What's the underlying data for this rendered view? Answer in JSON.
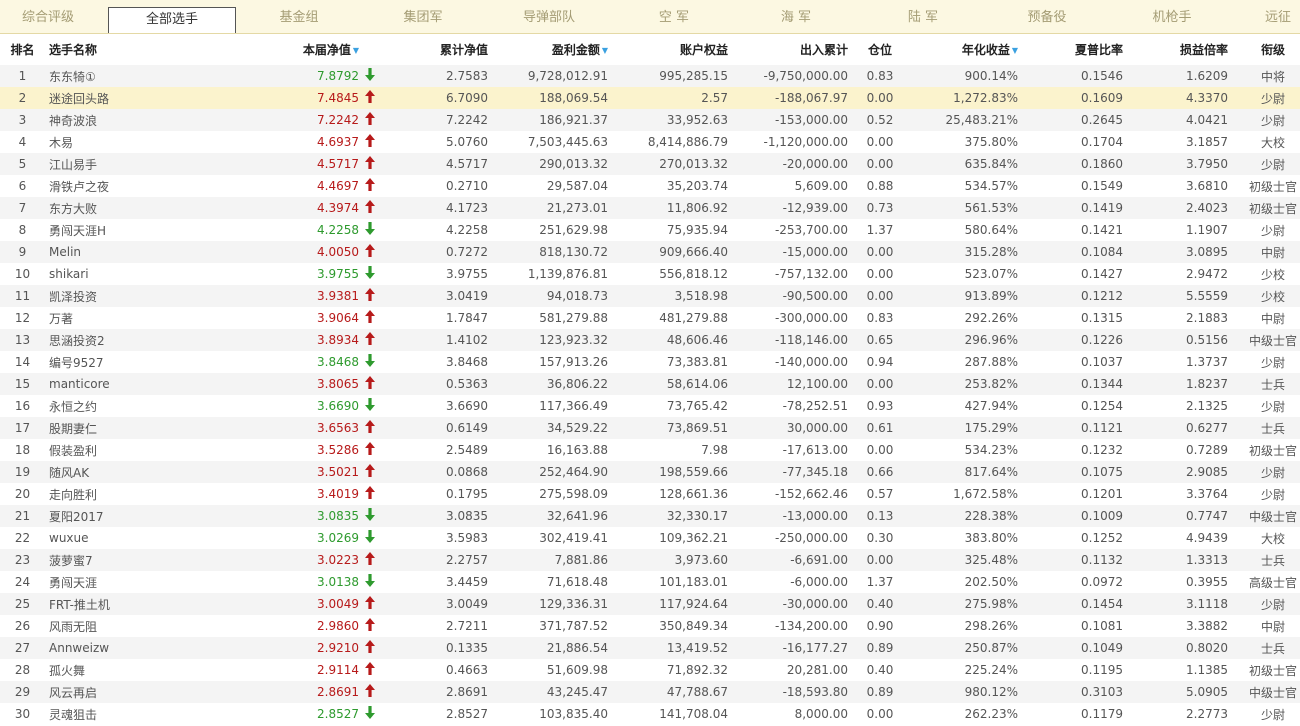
{
  "tabs": [
    "综合评级",
    "全部选手",
    "基金组",
    "集团军",
    "导弹部队",
    "空 军",
    "海 军",
    "陆 军",
    "预备役",
    "机枪手",
    "远征"
  ],
  "active_tab": 1,
  "headers": [
    "排名",
    "选手名称",
    "本届净值",
    "累计净值",
    "盈利金额",
    "账户权益",
    "出入累计",
    "仓位",
    "年化收益",
    "夏普比率",
    "损益倍率",
    "衔级"
  ],
  "sortable": [
    2,
    4,
    8
  ],
  "sort_arrow": "▼",
  "colors": {
    "up": "#b71a1a",
    "down": "#2e9a2e",
    "highlight": "#fbf3cd",
    "tabbar": "#fcf8e2"
  },
  "highlighted_row": 1,
  "rows": [
    {
      "rank": "1",
      "name": "东东犄①",
      "nav": "7.8792",
      "dir": "down",
      "cum": "2.7583",
      "profit": "9,728,012.91",
      "equity": "995,285.15",
      "flow": "-9,750,000.00",
      "pos": "0.83",
      "annual": "900.14%",
      "sharpe": "0.1546",
      "pl": "1.6209",
      "grade": "中将"
    },
    {
      "rank": "2",
      "name": "迷途回头路",
      "nav": "7.4845",
      "dir": "up",
      "cum": "6.7090",
      "profit": "188,069.54",
      "equity": "2.57",
      "flow": "-188,067.97",
      "pos": "0.00",
      "annual": "1,272.83%",
      "sharpe": "0.1609",
      "pl": "4.3370",
      "grade": "少尉"
    },
    {
      "rank": "3",
      "name": "神奇波浪",
      "nav": "7.2242",
      "dir": "up",
      "cum": "7.2242",
      "profit": "186,921.37",
      "equity": "33,952.63",
      "flow": "-153,000.00",
      "pos": "0.52",
      "annual": "25,483.21%",
      "sharpe": "0.2645",
      "pl": "4.0421",
      "grade": "少尉"
    },
    {
      "rank": "4",
      "name": "木易",
      "nav": "4.6937",
      "dir": "up",
      "cum": "5.0760",
      "profit": "7,503,445.63",
      "equity": "8,414,886.79",
      "flow": "-1,120,000.00",
      "pos": "0.00",
      "annual": "375.80%",
      "sharpe": "0.1704",
      "pl": "3.1857",
      "grade": "大校"
    },
    {
      "rank": "5",
      "name": "江山易手",
      "nav": "4.5717",
      "dir": "up",
      "cum": "4.5717",
      "profit": "290,013.32",
      "equity": "270,013.32",
      "flow": "-20,000.00",
      "pos": "0.00",
      "annual": "635.84%",
      "sharpe": "0.1860",
      "pl": "3.7950",
      "grade": "少尉"
    },
    {
      "rank": "6",
      "name": "滑铁卢之夜",
      "nav": "4.4697",
      "dir": "up",
      "cum": "0.2710",
      "profit": "29,587.04",
      "equity": "35,203.74",
      "flow": "5,609.00",
      "pos": "0.88",
      "annual": "534.57%",
      "sharpe": "0.1549",
      "pl": "3.6810",
      "grade": "初级士官"
    },
    {
      "rank": "7",
      "name": "东方大败",
      "nav": "4.3974",
      "dir": "up",
      "cum": "4.1723",
      "profit": "21,273.01",
      "equity": "11,806.92",
      "flow": "-12,939.00",
      "pos": "0.73",
      "annual": "561.53%",
      "sharpe": "0.1419",
      "pl": "2.4023",
      "grade": "初级士官"
    },
    {
      "rank": "8",
      "name": "勇闯天涯H",
      "nav": "4.2258",
      "dir": "down",
      "cum": "4.2258",
      "profit": "251,629.98",
      "equity": "75,935.94",
      "flow": "-253,700.00",
      "pos": "1.37",
      "annual": "580.64%",
      "sharpe": "0.1421",
      "pl": "1.1907",
      "grade": "少尉"
    },
    {
      "rank": "9",
      "name": "Melin",
      "nav": "4.0050",
      "dir": "up",
      "cum": "0.7272",
      "profit": "818,130.72",
      "equity": "909,666.40",
      "flow": "-15,000.00",
      "pos": "0.00",
      "annual": "315.28%",
      "sharpe": "0.1084",
      "pl": "3.0895",
      "grade": "中尉"
    },
    {
      "rank": "10",
      "name": "shikari",
      "nav": "3.9755",
      "dir": "down",
      "cum": "3.9755",
      "profit": "1,139,876.81",
      "equity": "556,818.12",
      "flow": "-757,132.00",
      "pos": "0.00",
      "annual": "523.07%",
      "sharpe": "0.1427",
      "pl": "2.9472",
      "grade": "少校"
    },
    {
      "rank": "11",
      "name": "凯泽投资",
      "nav": "3.9381",
      "dir": "up",
      "cum": "3.0419",
      "profit": "94,018.73",
      "equity": "3,518.98",
      "flow": "-90,500.00",
      "pos": "0.00",
      "annual": "913.89%",
      "sharpe": "0.1212",
      "pl": "5.5559",
      "grade": "少校"
    },
    {
      "rank": "12",
      "name": "万著",
      "nav": "3.9064",
      "dir": "up",
      "cum": "1.7847",
      "profit": "581,279.88",
      "equity": "481,279.88",
      "flow": "-300,000.00",
      "pos": "0.83",
      "annual": "292.26%",
      "sharpe": "0.1315",
      "pl": "2.1883",
      "grade": "中尉"
    },
    {
      "rank": "13",
      "name": "思涵投资2",
      "nav": "3.8934",
      "dir": "up",
      "cum": "1.4102",
      "profit": "123,923.32",
      "equity": "48,606.46",
      "flow": "-118,146.00",
      "pos": "0.65",
      "annual": "296.96%",
      "sharpe": "0.1226",
      "pl": "0.5156",
      "grade": "中级士官"
    },
    {
      "rank": "14",
      "name": "编号9527",
      "nav": "3.8468",
      "dir": "down",
      "cum": "3.8468",
      "profit": "157,913.26",
      "equity": "73,383.81",
      "flow": "-140,000.00",
      "pos": "0.94",
      "annual": "287.88%",
      "sharpe": "0.1037",
      "pl": "1.3737",
      "grade": "少尉"
    },
    {
      "rank": "15",
      "name": "manticore",
      "nav": "3.8065",
      "dir": "up",
      "cum": "0.5363",
      "profit": "36,806.22",
      "equity": "58,614.06",
      "flow": "12,100.00",
      "pos": "0.00",
      "annual": "253.82%",
      "sharpe": "0.1344",
      "pl": "1.8237",
      "grade": "士兵"
    },
    {
      "rank": "16",
      "name": "永恒之约",
      "nav": "3.6690",
      "dir": "down",
      "cum": "3.6690",
      "profit": "117,366.49",
      "equity": "73,765.42",
      "flow": "-78,252.51",
      "pos": "0.93",
      "annual": "427.94%",
      "sharpe": "0.1254",
      "pl": "2.1325",
      "grade": "少尉"
    },
    {
      "rank": "17",
      "name": "股期妻仁",
      "nav": "3.6563",
      "dir": "up",
      "cum": "0.6149",
      "profit": "34,529.22",
      "equity": "73,869.51",
      "flow": "30,000.00",
      "pos": "0.61",
      "annual": "175.29%",
      "sharpe": "0.1121",
      "pl": "0.6277",
      "grade": "士兵"
    },
    {
      "rank": "18",
      "name": "假装盈利",
      "nav": "3.5286",
      "dir": "up",
      "cum": "2.5489",
      "profit": "16,163.88",
      "equity": "7.98",
      "flow": "-17,613.00",
      "pos": "0.00",
      "annual": "534.23%",
      "sharpe": "0.1232",
      "pl": "0.7289",
      "grade": "初级士官"
    },
    {
      "rank": "19",
      "name": "随风AK",
      "nav": "3.5021",
      "dir": "up",
      "cum": "0.0868",
      "profit": "252,464.90",
      "equity": "198,559.66",
      "flow": "-77,345.18",
      "pos": "0.66",
      "annual": "817.64%",
      "sharpe": "0.1075",
      "pl": "2.9085",
      "grade": "少尉"
    },
    {
      "rank": "20",
      "name": "走向胜利",
      "nav": "3.4019",
      "dir": "up",
      "cum": "0.1795",
      "profit": "275,598.09",
      "equity": "128,661.36",
      "flow": "-152,662.46",
      "pos": "0.57",
      "annual": "1,672.58%",
      "sharpe": "0.1201",
      "pl": "3.3764",
      "grade": "少尉"
    },
    {
      "rank": "21",
      "name": "夏阳2017",
      "nav": "3.0835",
      "dir": "down",
      "cum": "3.0835",
      "profit": "32,641.96",
      "equity": "32,330.17",
      "flow": "-13,000.00",
      "pos": "0.13",
      "annual": "228.38%",
      "sharpe": "0.1009",
      "pl": "0.7747",
      "grade": "中级士官"
    },
    {
      "rank": "22",
      "name": "wuxue",
      "nav": "3.0269",
      "dir": "down",
      "cum": "3.5983",
      "profit": "302,419.41",
      "equity": "109,362.21",
      "flow": "-250,000.00",
      "pos": "0.30",
      "annual": "383.80%",
      "sharpe": "0.1252",
      "pl": "4.9439",
      "grade": "大校"
    },
    {
      "rank": "23",
      "name": "菠萝蜜7",
      "nav": "3.0223",
      "dir": "up",
      "cum": "2.2757",
      "profit": "7,881.86",
      "equity": "3,973.60",
      "flow": "-6,691.00",
      "pos": "0.00",
      "annual": "325.48%",
      "sharpe": "0.1132",
      "pl": "1.3313",
      "grade": "士兵"
    },
    {
      "rank": "24",
      "name": "勇闯天涯",
      "nav": "3.0138",
      "dir": "down",
      "cum": "3.4459",
      "profit": "71,618.48",
      "equity": "101,183.01",
      "flow": "-6,000.00",
      "pos": "1.37",
      "annual": "202.50%",
      "sharpe": "0.0972",
      "pl": "0.3955",
      "grade": "高级士官"
    },
    {
      "rank": "25",
      "name": "FRT-推土机",
      "nav": "3.0049",
      "dir": "up",
      "cum": "3.0049",
      "profit": "129,336.31",
      "equity": "117,924.64",
      "flow": "-30,000.00",
      "pos": "0.40",
      "annual": "275.98%",
      "sharpe": "0.1454",
      "pl": "3.1118",
      "grade": "少尉"
    },
    {
      "rank": "26",
      "name": "风雨无阻",
      "nav": "2.9860",
      "dir": "up",
      "cum": "2.7211",
      "profit": "371,787.52",
      "equity": "350,849.34",
      "flow": "-134,200.00",
      "pos": "0.90",
      "annual": "298.26%",
      "sharpe": "0.1081",
      "pl": "3.3882",
      "grade": "中尉"
    },
    {
      "rank": "27",
      "name": "Annweizw",
      "nav": "2.9210",
      "dir": "up",
      "cum": "0.1335",
      "profit": "21,886.54",
      "equity": "13,419.52",
      "flow": "-16,177.27",
      "pos": "0.89",
      "annual": "250.87%",
      "sharpe": "0.1049",
      "pl": "0.8020",
      "grade": "士兵"
    },
    {
      "rank": "28",
      "name": "孤火舞",
      "nav": "2.9114",
      "dir": "up",
      "cum": "0.4663",
      "profit": "51,609.98",
      "equity": "71,892.32",
      "flow": "20,281.00",
      "pos": "0.40",
      "annual": "225.24%",
      "sharpe": "0.1195",
      "pl": "1.1385",
      "grade": "初级士官"
    },
    {
      "rank": "29",
      "name": "风云再启",
      "nav": "2.8691",
      "dir": "up",
      "cum": "2.8691",
      "profit": "43,245.47",
      "equity": "47,788.67",
      "flow": "-18,593.80",
      "pos": "0.89",
      "annual": "980.12%",
      "sharpe": "0.3103",
      "pl": "5.0905",
      "grade": "中级士官"
    },
    {
      "rank": "30",
      "name": "灵魂狙击",
      "nav": "2.8527",
      "dir": "down",
      "cum": "2.8527",
      "profit": "103,835.40",
      "equity": "141,708.04",
      "flow": "8,000.00",
      "pos": "0.00",
      "annual": "262.23%",
      "sharpe": "0.1179",
      "pl": "2.2773",
      "grade": "少尉"
    }
  ]
}
